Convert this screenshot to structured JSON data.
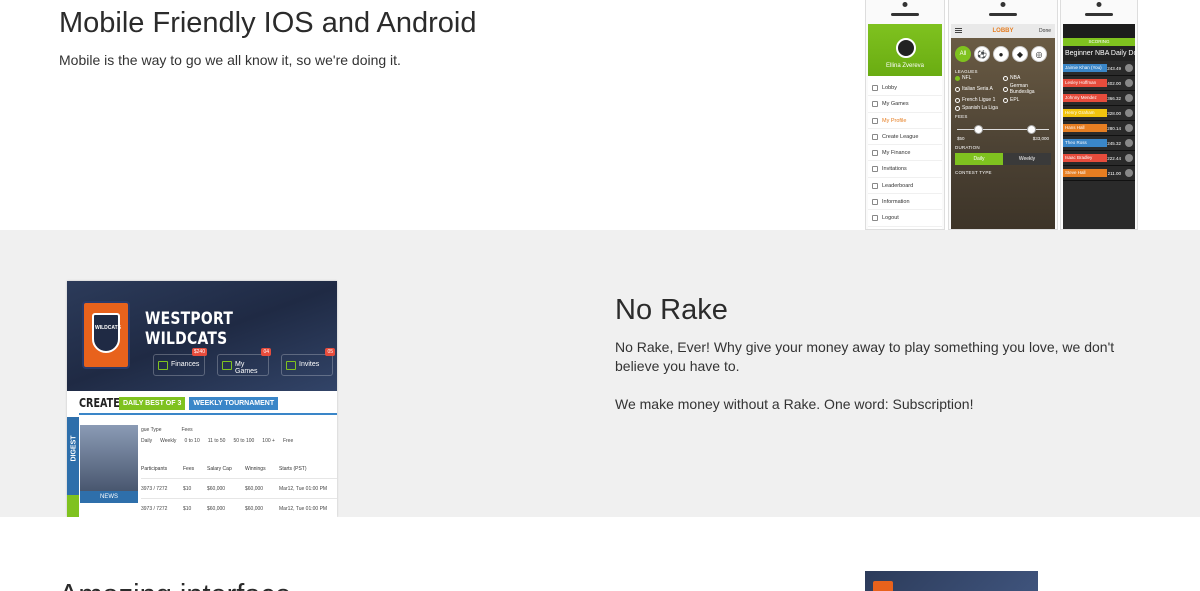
{
  "mobile": {
    "title": "Mobile Friendly IOS and Android",
    "text": "Mobile is the way to go we all know it, so we're doing it.",
    "phone_left": {
      "user_name": "Ellina Zvereva",
      "menu": [
        "Lobby",
        "My Games",
        "My Profile",
        "Create League",
        "My Finance",
        "Invitations",
        "Leaderboard",
        "Information",
        "Logout"
      ],
      "active_item": "My Profile"
    },
    "phone_mid": {
      "title": "LOBBY",
      "done": "Done",
      "all": "All",
      "leagues_label": "LEAGUES",
      "leagues": [
        "NFL",
        "NBA",
        "Italian Seria A",
        "German Bundesliga",
        "French Ligue 1",
        "EPL",
        "Spanish La Liga"
      ],
      "fees_label": "FEES",
      "fee_min": "$50",
      "fee_max": "$33,000",
      "duration_label": "DURATION",
      "duration_options": [
        "Daily",
        "Weekly"
      ],
      "contest_label": "CONTEST TYPE"
    },
    "phone_right": {
      "header": "SCORING",
      "title": "Beginner NBA Daily Dollar",
      "rows": [
        {
          "name": "Jaimie Khan (You)",
          "score": "243.49",
          "color": "#3a86c8"
        },
        {
          "name": "Lesley Hoffman",
          "score": "402.00",
          "color": "#e74c3c"
        },
        {
          "name": "Johnny Mendez",
          "score": "366.32",
          "color": "#e74c3c"
        },
        {
          "name": "Henry Graham",
          "score": "328.00",
          "color": "#f1c40f"
        },
        {
          "name": "Hans Hall",
          "score": "280.14",
          "color": "#e67e22"
        },
        {
          "name": "Theo Ross",
          "score": "245.32",
          "color": "#3a86c8"
        },
        {
          "name": "Isaac Bradley",
          "score": "222.44",
          "color": "#e74c3c"
        },
        {
          "name": "Steve Hall",
          "score": "211.00",
          "color": "#e67e22"
        }
      ]
    }
  },
  "rake": {
    "title": "No Rake",
    "p1": "No Rake, Ever!  Why give your money away to play something you love, we don't believe you have to.",
    "p2": "We make money without a Rake. One word: Subscription!",
    "image": {
      "team": "WESTPORT WILDCATS",
      "logo_text": "WILDCATS",
      "tiles": [
        {
          "label": "Finances",
          "badge": "$240"
        },
        {
          "label": "My Games",
          "badge": "04"
        },
        {
          "label": "Invites",
          "badge": "05"
        }
      ],
      "create": "CREATE",
      "pill_green": "DAILY BEST OF 3",
      "pill_blue": "WEEKLY TOURNAMENT",
      "side_label": "DIGEST",
      "news": "NEWS",
      "game_type_label": "gue Type",
      "fees_label": "Fees",
      "type_options": [
        "Daily",
        "Weekly"
      ],
      "fee_options": [
        "0 to 10",
        "11 to 50",
        "50 to 100",
        "100 +",
        "Free"
      ],
      "columns": [
        "Participants",
        "Fees",
        "Salary Cap",
        "Winnings",
        "Starts (PST)"
      ],
      "rows": [
        [
          "3973 / 7272",
          "$10",
          "$60,000",
          "$60,000",
          "Mar12, Tue 01:00 PM"
        ],
        [
          "3973 / 7272",
          "$10",
          "$60,000",
          "$60,000",
          "Mar12, Tue 01:00 PM"
        ]
      ]
    }
  },
  "next": {
    "title": "Amazing interface"
  }
}
